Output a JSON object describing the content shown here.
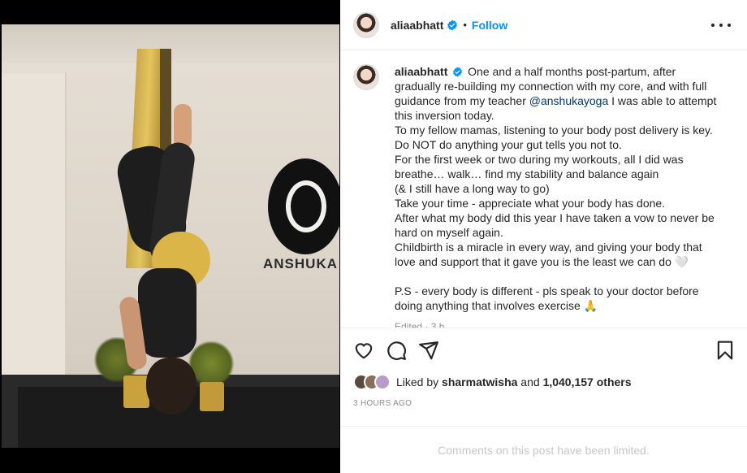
{
  "header": {
    "username": "aliaabhatt",
    "separator": "•",
    "follow_label": "Follow"
  },
  "caption": {
    "username": "aliaabhatt",
    "first_text": "One and a half months post-partum, after gradually re-building my connection with my core, and with full guidance from my teacher ",
    "mention": "@anshukayoga",
    "after_mention": " I was able to attempt this inversion today.",
    "lines": [
      "To my fellow mamas, listening to your body post delivery is key.",
      "Do NOT do anything your gut tells you not to.",
      "For the first week or two during my workouts, all I did was breathe… walk… find my stability and balance again",
      "(& I still have a long way to go)",
      "Take your time - appreciate what your body has done.",
      "After what my body did this year I have taken a vow to never be hard on myself again.",
      "Childbirth is a miracle in every way, and giving your body that love and support that it gave you is the least we can do 🤍"
    ],
    "ps": "P.S - every body is different - pls speak to your doctor before doing anything that involves exercise 🙏",
    "edited": "Edited · 3 h"
  },
  "likes": {
    "prefix": "Liked by ",
    "user": "sharmatwisha",
    "middle": " and ",
    "count": "1,040,157 others"
  },
  "timestamp": "3 HOURS AGO",
  "comments_notice": "Comments on this post have been limited.",
  "media": {
    "studio_sign": "ANSHUKA YO"
  },
  "icons": [
    "verified-badge-icon",
    "more-options-icon",
    "heart-icon",
    "comment-icon",
    "share-icon",
    "bookmark-icon"
  ],
  "colors": {
    "follow": "#0095f6",
    "verified": "#0095f6",
    "muted": "#8e8e8e"
  }
}
